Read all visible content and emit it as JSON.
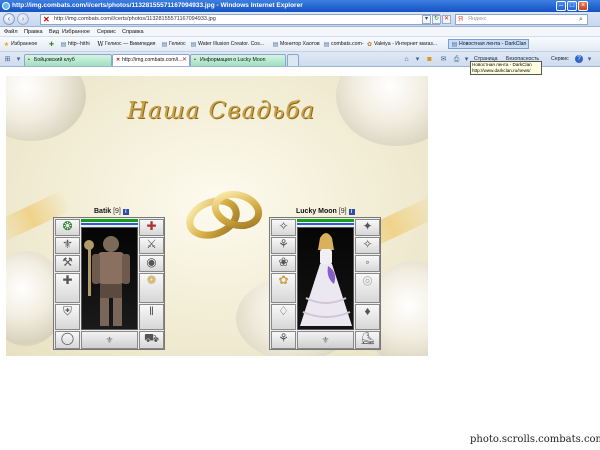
{
  "window": {
    "title": "http://img.combats.com/i/certs/photos/11328155571167094933.jpg - Windows Internet Explorer"
  },
  "addressbar": {
    "url": "http://img.combats.com/i/certs/photos/11328155571167094933.jpg",
    "search_placeholder": "Яндекс"
  },
  "menu": {
    "items": [
      "Файл",
      "Правка",
      "Вид",
      "Избранное",
      "Сервис",
      "Справка"
    ]
  },
  "favorites": {
    "label": "Избранное",
    "items": [
      "http--hithi",
      "Гелиос — Википедия",
      "Гелиос",
      "Water Illusion Creator. Cos...",
      "Монитор Хаотов",
      "combats.com-",
      "Valeiya - Интернет магаз...",
      "Новостная лента - DarkClan"
    ]
  },
  "tabs": [
    {
      "label": "Бойцовский клуб"
    },
    {
      "label": "http://img.combats.com/i..."
    },
    {
      "label": "Информация о Lucky Moon"
    }
  ],
  "commands": {
    "page": "Страница",
    "security": "Безопасность",
    "service": "Сервис"
  },
  "tooltip": {
    "line1": "Новостная лента - DarkClan",
    "line2": "http://www.darkclan.ru/news/"
  },
  "photo": {
    "heading": "Наша Свадьба",
    "left": {
      "name": "Batik",
      "level": "[9]",
      "info": "i"
    },
    "right": {
      "name": "Lucky Moon",
      "level": "[9]",
      "info": "i"
    }
  },
  "watermark": "photo.scrolls.combats.com"
}
